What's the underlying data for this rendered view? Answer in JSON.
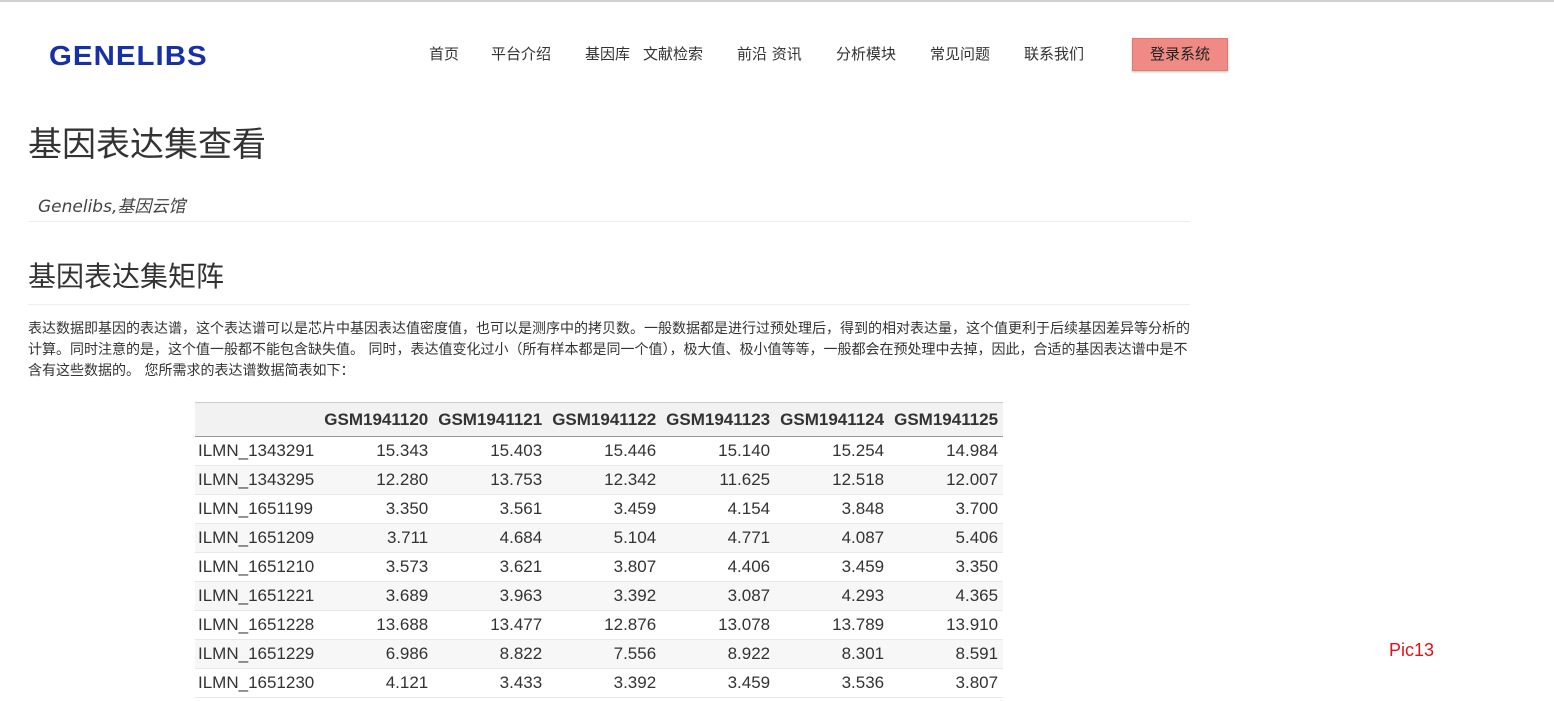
{
  "header": {
    "logo": "GENELIBS",
    "nav": [
      "首页",
      "平台介绍",
      "基因库",
      "文献检索",
      "前沿 资讯",
      "分析模块",
      "常见问题",
      "联系我们"
    ],
    "login_label": "登录系统"
  },
  "page": {
    "title": "基因表达集查看",
    "subtitle": "Genelibs,基因云馆",
    "section_title": "基因表达集矩阵",
    "description": "表达数据即基因的表达谱，这个表达谱可以是芯片中基因表达值密度值，也可以是测序中的拷贝数。一般数据都是进行过预处理后，得到的相对表达量，这个值更利于后续基因差异等分析的计算。同时注意的是，这个值一般都不能包含缺失值。 同时，表达值变化过小（所有样本都是同一个值），极大值、极小值等等，一般都会在预处理中去掉，因此，合适的基因表达谱中是不含有这些数据的。 您所需求的表达谱数据简表如下："
  },
  "table": {
    "columns": [
      "",
      "GSM1941120",
      "GSM1941121",
      "GSM1941122",
      "GSM1941123",
      "GSM1941124",
      "GSM1941125"
    ],
    "rows": [
      [
        "ILMN_1343291",
        "15.343",
        "15.403",
        "15.446",
        "15.140",
        "15.254",
        "14.984"
      ],
      [
        "ILMN_1343295",
        "12.280",
        "13.753",
        "12.342",
        "11.625",
        "12.518",
        "12.007"
      ],
      [
        "ILMN_1651199",
        "3.350",
        "3.561",
        "3.459",
        "4.154",
        "3.848",
        "3.700"
      ],
      [
        "ILMN_1651209",
        "3.711",
        "4.684",
        "5.104",
        "4.771",
        "4.087",
        "5.406"
      ],
      [
        "ILMN_1651210",
        "3.573",
        "3.621",
        "3.807",
        "4.406",
        "3.459",
        "3.350"
      ],
      [
        "ILMN_1651221",
        "3.689",
        "3.963",
        "3.392",
        "3.087",
        "4.293",
        "4.365"
      ],
      [
        "ILMN_1651228",
        "13.688",
        "13.477",
        "12.876",
        "13.078",
        "13.789",
        "13.910"
      ],
      [
        "ILMN_1651229",
        "6.986",
        "8.822",
        "7.556",
        "8.922",
        "8.301",
        "8.591"
      ],
      [
        "ILMN_1651230",
        "4.121",
        "3.433",
        "3.392",
        "3.459",
        "3.536",
        "3.807"
      ]
    ]
  },
  "annotation": "Pic13",
  "colors": {
    "logo": "#1730a6",
    "login_button": "#f08a84",
    "annotation": "#e0111a"
  }
}
